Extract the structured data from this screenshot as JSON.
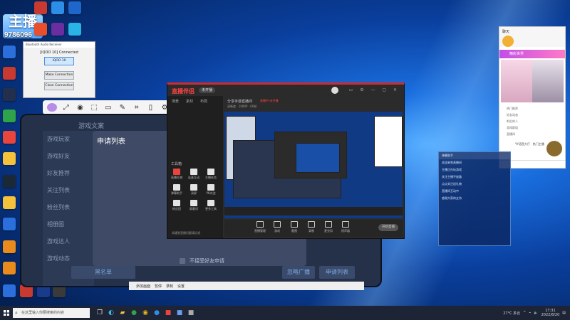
{
  "desktop": {
    "overlay_logo": "主播",
    "overlay_number": "9786096",
    "icons": [
      {
        "name": "app-red-icon",
        "color": "#c8392f",
        "label": ""
      },
      {
        "name": "app-qq-icon",
        "color": "#2d8ee8",
        "label": ""
      },
      {
        "name": "app-browser-icon",
        "color": "#1e66c9",
        "label": ""
      },
      {
        "name": "app-game1-icon",
        "color": "#6a2ea0",
        "label": ""
      },
      {
        "name": "app-steam-icon",
        "color": "#23304d",
        "label": ""
      },
      {
        "name": "app-green-icon",
        "color": "#2fa34a",
        "label": ""
      },
      {
        "name": "app-orange-icon",
        "color": "#e88a1c",
        "label": ""
      },
      {
        "name": "app-chrome-icon",
        "color": "#e5b51c",
        "label": ""
      },
      {
        "name": "app-blue-icon",
        "color": "#2b6fdc",
        "label": ""
      },
      {
        "name": "app-yellow-icon",
        "color": "#f4c33b",
        "label": ""
      }
    ]
  },
  "bluetooth_window": {
    "title": "Bluetooth Audio Receiver",
    "status": "[iQOO 10] Connected",
    "primary_button": "iQOO 10",
    "secondary_button": "Make Connection",
    "close_button": "Close Connection"
  },
  "dark_app": {
    "header": "游戏文案",
    "sidebar": [
      "游戏玩家",
      "游戏好友",
      "好友推荐",
      "关注列表",
      "粉丝列表",
      "相册图",
      "游戏达人",
      "游戏动态"
    ],
    "list_title": "申请列表",
    "checkbox_label": "不接受好友申请",
    "buttons": {
      "blacklist": "黑名单",
      "ignore": "忽略广播",
      "apply": "申请列表"
    }
  },
  "stream_app": {
    "brand": "直播伴侣",
    "live_tag": "未开播",
    "room_title": "分享手游直播间",
    "category": "手游",
    "red_tag": "直播中-未开播",
    "info_line2": "清晰度 · 1080P · 60帧",
    "tabs": [
      "场景",
      "素材",
      "布局"
    ],
    "tools_title": "工具箱",
    "tools": [
      {
        "label": "直播礼物",
        "red": true
      },
      {
        "label": "连麦互动",
        "red": false
      },
      {
        "label": "主播任务",
        "red": false
      },
      {
        "label": "弹幕助手",
        "red": false
      },
      {
        "label": "录屏",
        "red": false
      },
      {
        "label": "PK对战",
        "red": false
      },
      {
        "label": "粉丝团",
        "red": false
      },
      {
        "label": "屏蔽词",
        "red": false
      },
      {
        "label": "更多工具",
        "red": false
      }
    ],
    "footer_note": "如遇到直播问题请反馈",
    "bottom_tools": [
      "直播管理",
      "游戏",
      "截图",
      "录制",
      "麦克风",
      "扬声器"
    ],
    "start_live": "开始直播"
  },
  "chat_panel": {
    "header": "聊天",
    "banner": "精彩世界",
    "list": [
      "热门推荐",
      "好友动态",
      "附近的人",
      "游戏群组",
      "直播间"
    ],
    "user_line": "YY语音大厅 · 热门主播"
  },
  "danmu_window": {
    "title": "弹幕助手",
    "lines": [
      "欢迎来到直播间",
      "主播正在玩游戏",
      "关注主播不迷路",
      "点点关注送礼物",
      "直播间互动中",
      "感谢大家的支持"
    ]
  },
  "mini_bar": {
    "items": [
      "添加画面",
      "暂停",
      "录制",
      "设置"
    ]
  },
  "taskbar": {
    "search_placeholder": "在这里输入你要搜索的内容",
    "weather": "27°C 多云",
    "time": "17:31",
    "date": "2022/8/20"
  }
}
